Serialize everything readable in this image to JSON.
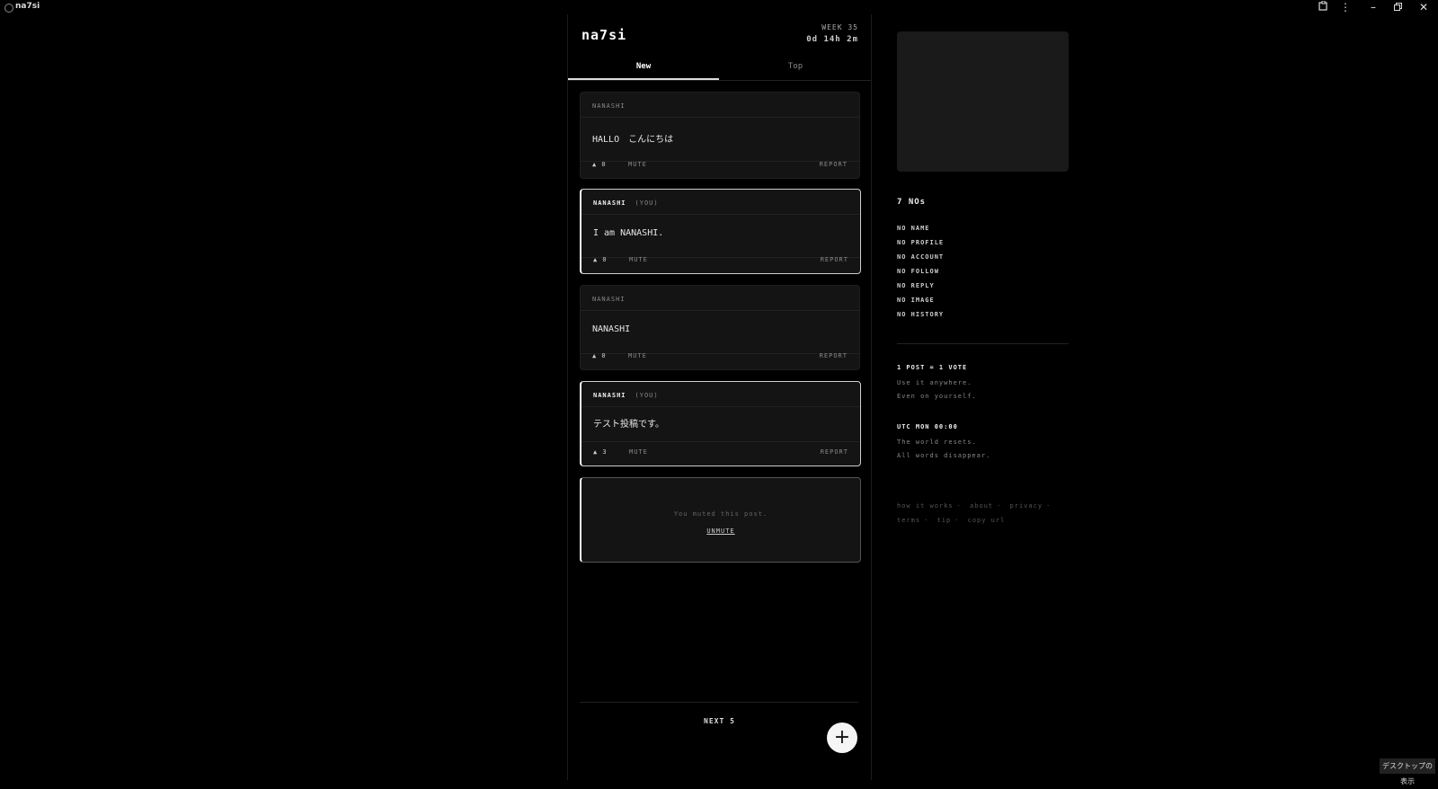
{
  "window": {
    "title": "na7si"
  },
  "header": {
    "brand": "na7si",
    "week": "WEEK 35",
    "countdown": "0d 14h 2m"
  },
  "tabs": [
    {
      "label": "New"
    },
    {
      "label": "Top"
    }
  ],
  "posts": [
    {
      "author": "NANASHI",
      "you": "",
      "body": "HALLO　こんにちは",
      "votes": "▲ 0",
      "mute": "MUTE",
      "report": "REPORT"
    },
    {
      "author": "NANASHI",
      "you": "(YOU)",
      "body": "I am NANASHI.",
      "votes": "▲ 0",
      "mute": "MUTE",
      "report": "REPORT"
    },
    {
      "author": "NANASHI",
      "you": "",
      "body": "NANASHI",
      "votes": "▲ 0",
      "mute": "MUTE",
      "report": "REPORT"
    },
    {
      "author": "NANASHI",
      "you": "(YOU)",
      "body": "テスト投稿です。",
      "votes": "▲ 3",
      "mute": "MUTE",
      "report": "REPORT"
    }
  ],
  "muted_post": {
    "note": "You muted this post.",
    "unmute": "UNMUTE"
  },
  "next": "NEXT 5",
  "fab": "+",
  "sidebar": {
    "nos_title": "7 NOs",
    "nos": [
      "NO NAME",
      "NO PROFILE",
      "NO ACCOUNT",
      "NO FOLLOW",
      "NO REPLY",
      "NO IMAGE",
      "NO HISTORY"
    ],
    "rule1": {
      "head": "1 POST = 1 VOTE",
      "line1": "Use it anywhere.",
      "line2": "Even on yourself."
    },
    "rule2": {
      "head": "UTC MON 00:00",
      "line1": "The world resets.",
      "line2": "All words disappear."
    },
    "links": [
      "how it works",
      "about",
      "privacy",
      "terms",
      "tip",
      "copy url"
    ],
    "link_sep": "·"
  },
  "desktop_badge": "デスクトップの表示",
  "icons": {
    "extensions": "puzzle-icon",
    "menu": "kebab-icon"
  }
}
